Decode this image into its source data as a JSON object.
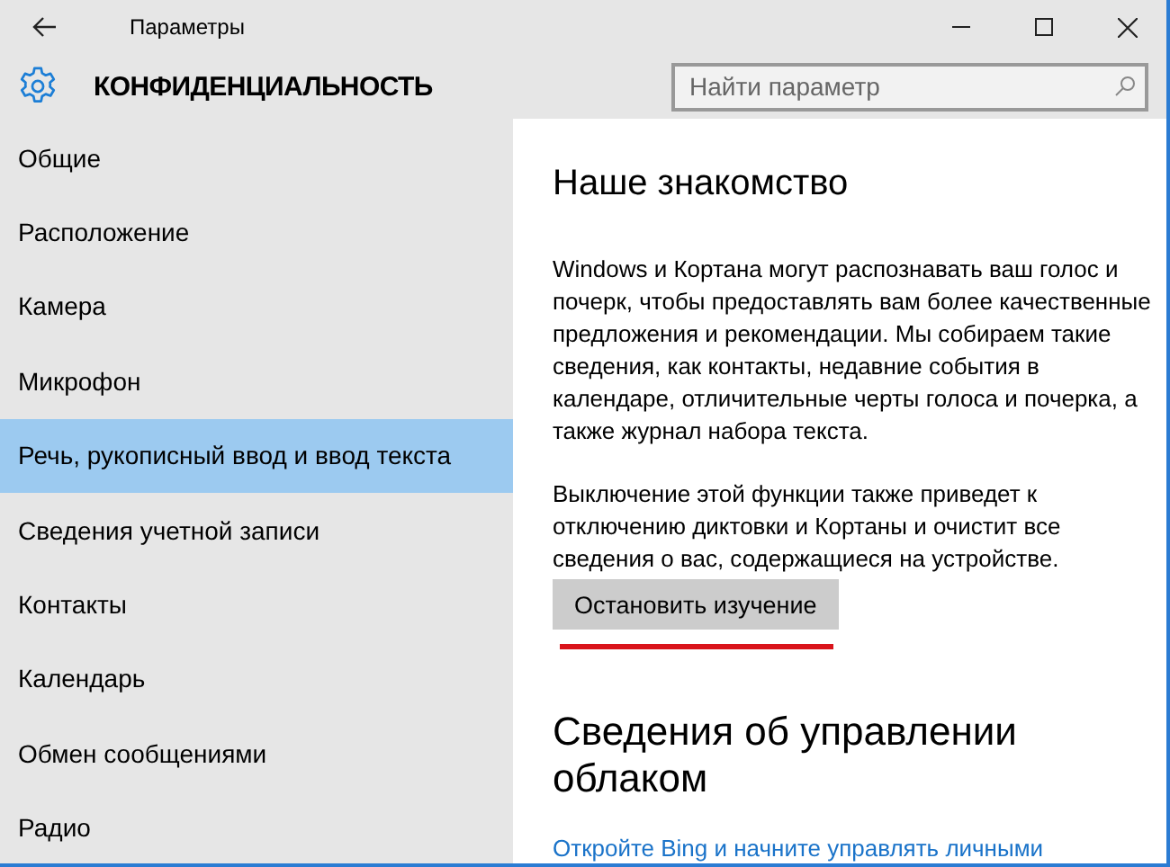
{
  "window": {
    "title": "Параметры"
  },
  "header": {
    "title": "КОНФИДЕНЦИАЛЬНОСТЬ",
    "search": {
      "placeholder": "Найти параметр"
    }
  },
  "sidebar": {
    "items": [
      {
        "label": "Общие",
        "selected": false
      },
      {
        "label": "Расположение",
        "selected": false
      },
      {
        "label": "Камера",
        "selected": false
      },
      {
        "label": "Микрофон",
        "selected": false
      },
      {
        "label": "Речь, рукописный ввод и ввод текста",
        "selected": true
      },
      {
        "label": "Сведения учетной записи",
        "selected": false
      },
      {
        "label": "Контакты",
        "selected": false
      },
      {
        "label": "Календарь",
        "selected": false
      },
      {
        "label": "Обмен сообщениями",
        "selected": false
      },
      {
        "label": "Радио",
        "selected": false
      }
    ]
  },
  "content": {
    "sections": [
      {
        "heading": "Наше знакомство",
        "paragraphs": [
          "Windows и Кортана могут распознавать ваш голос и почерк, чтобы предоставлять вам более качественные предложения и рекомендации. Мы собираем такие сведения, как контакты, недавние события в календаре, отличительные черты голоса и почерка, а также журнал набора текста.",
          "Выключение этой функции также приведет к отключению диктовки и Кортаны и очистит все сведения о вас, содержащиеся на устройстве."
        ],
        "button": {
          "label": "Остановить изучение",
          "underlined": true
        }
      },
      {
        "heading": "Сведения об управлении облаком",
        "link": "Откройте Bing и начните управлять личными"
      }
    ]
  }
}
